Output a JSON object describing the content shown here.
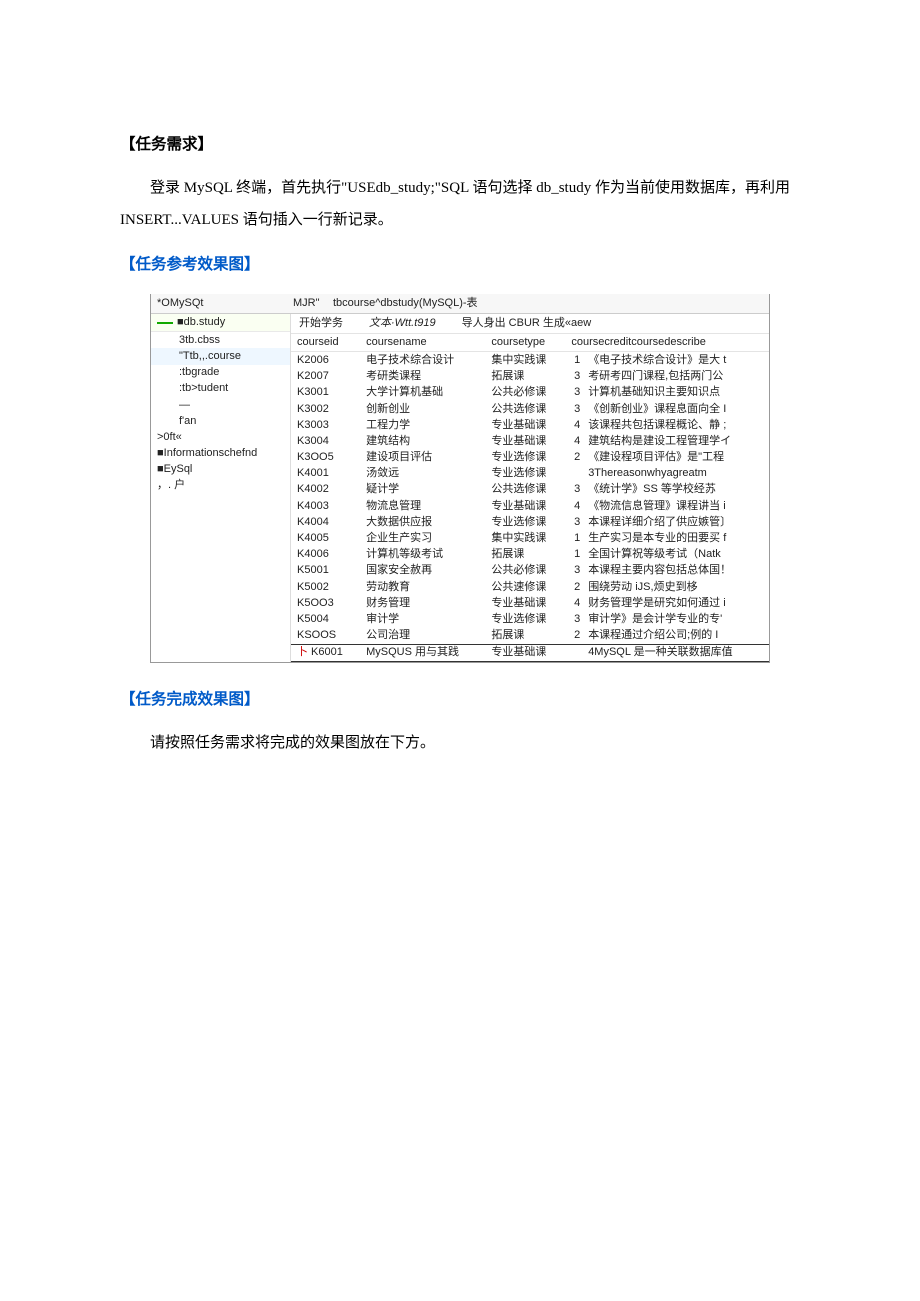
{
  "sections": {
    "req_title": "【任务需求】",
    "req_body_pre": "登录 ",
    "req_body_mysql": "MySQL ",
    "req_body_mid1": "终端，首先执行",
    "req_body_sql": "\"USEdb_study;\"SQL ",
    "req_body_mid2": "语句选择 ",
    "req_body_db": "db_study ",
    "req_body_mid3": "作为当前使用数据库，再利用 ",
    "req_body_ins": "INSERT...VALUES ",
    "req_body_end": "语句插入一行新记录。",
    "ref_title": "【任务参考效果图】",
    "done_title": "【任务完成效果图】",
    "done_body": "请按照任务需求将完成的效果图放在下方。"
  },
  "app": {
    "header_left": "*OMySQt",
    "header_mid": "MJR\"",
    "header_right": "tbcourse^dbstudy(MySQL)-表",
    "dbline": "■db.study",
    "sidebar_items": [
      {
        "label": "3tb.cbss",
        "hl": false
      },
      {
        "label": "\"Ttb,,.course",
        "hl": true
      },
      {
        "label": ":tbgrade",
        "hl": false
      },
      {
        "label": ":tb>tudent",
        "hl": false
      },
      {
        "label": "—",
        "hl": false
      },
      {
        "label": "f'an",
        "hl": false
      },
      {
        "label": ">0ft«",
        "hl": false
      },
      {
        "label": "■Informationschefnd",
        "hl": false
      },
      {
        "label": "■EySql",
        "hl": false
      },
      {
        "label": "，. 户",
        "hl": false
      }
    ],
    "toolbar": {
      "t1": "开始学务",
      "t2": "文本·Wtt.t919",
      "t3": "导人身出 CBUR 生成«aew"
    },
    "columns": {
      "c1": "courseid",
      "c2": "coursename",
      "c3": "coursetype",
      "c4": "coursecredit",
      "c5": "coursedescribe"
    },
    "rows": [
      {
        "id": "K2006",
        "name": "电子技术综合设计",
        "type": "集中实践课",
        "credit": "1",
        "desc": "《电子技术综合设计》是大 t"
      },
      {
        "id": "K2007",
        "name": "考研类课程",
        "type": "拓展课",
        "credit": "3",
        "desc": "考研考四门课程,包括两门公"
      },
      {
        "id": "K3001",
        "name": "大学计算机基础",
        "type": "公共必修课",
        "credit": "3",
        "desc": "计算机基础知识主要知识点"
      },
      {
        "id": "K3002",
        "name": "创新创业",
        "type": "公共选修课",
        "credit": "3",
        "desc": "《创新创业》课程息面向全 I"
      },
      {
        "id": "K3003",
        "name": "工程力学",
        "type": "专业基础课",
        "credit": "4",
        "desc": "该课程共包括课程概论、静 ;"
      },
      {
        "id": "K3004",
        "name": "建筑结构",
        "type": "专业基础课",
        "credit": "4",
        "desc": "建筑结构是建设工程管理学イ"
      },
      {
        "id": "K3OO5",
        "name": "建设项目评估",
        "type": "专业选修课",
        "credit": "2",
        "desc": "《建设程项目评估》是\"工程"
      },
      {
        "id": "K4001",
        "name": "汤敛远",
        "type": "专业选修课",
        "credit": "",
        "desc": "3Thereasonwhyagreatm"
      },
      {
        "id": "K4002",
        "name": "疑计学",
        "type": "公共选修课",
        "credit": "3",
        "desc": "《统计学》SS 等学校经苏"
      },
      {
        "id": "K4003",
        "name": "物流息管理",
        "type": "专业基础课",
        "credit": "4",
        "desc": "《物流信息管理》课程讲当 i"
      },
      {
        "id": "K4004",
        "name": "大数据供应报",
        "type": "专业选修课",
        "credit": "3",
        "desc": "本课程详细介绍了供应嫉管〕"
      },
      {
        "id": "K4005",
        "name": "企业生产实习",
        "type": "集中实践课",
        "credit": "1",
        "desc": "生产实习是本专业的田要买 f"
      },
      {
        "id": "K4006",
        "name": "计算机等级考试",
        "type": "拓展课",
        "credit": "1",
        "desc": "全国计算祝等级考试（Natk"
      },
      {
        "id": "K5001",
        "name": "国家安全赦再",
        "type": "公共必修课",
        "credit": "3",
        "desc": "本课程主要内容包括总体国！"
      },
      {
        "id": "K5002",
        "name": "劳动教育",
        "type": "公共速修课",
        "credit": "2",
        "desc": "围绕劳动 iJS,烦史到栘"
      },
      {
        "id": "K5OO3",
        "name": "财务管理",
        "type": "专业基础课",
        "credit": "4",
        "desc": "财务管理学是研究如何通过 i"
      },
      {
        "id": "K5004",
        "name": "审计学",
        "type": "专业选修课",
        "credit": "3",
        "desc": "审计学》是会计学专业的专'"
      },
      {
        "id": "KSOOS",
        "name": "公司治理",
        "type": "拓展课",
        "credit": "2",
        "desc": "本课程通过介绍公司;例的 I"
      }
    ],
    "lastrow": {
      "marker": "卜",
      "id": "K6001",
      "name": "MySQUS 用与其践",
      "type": "专业基础课",
      "credit": "",
      "desc": "4MySQL 是一种关联数据库值"
    }
  }
}
